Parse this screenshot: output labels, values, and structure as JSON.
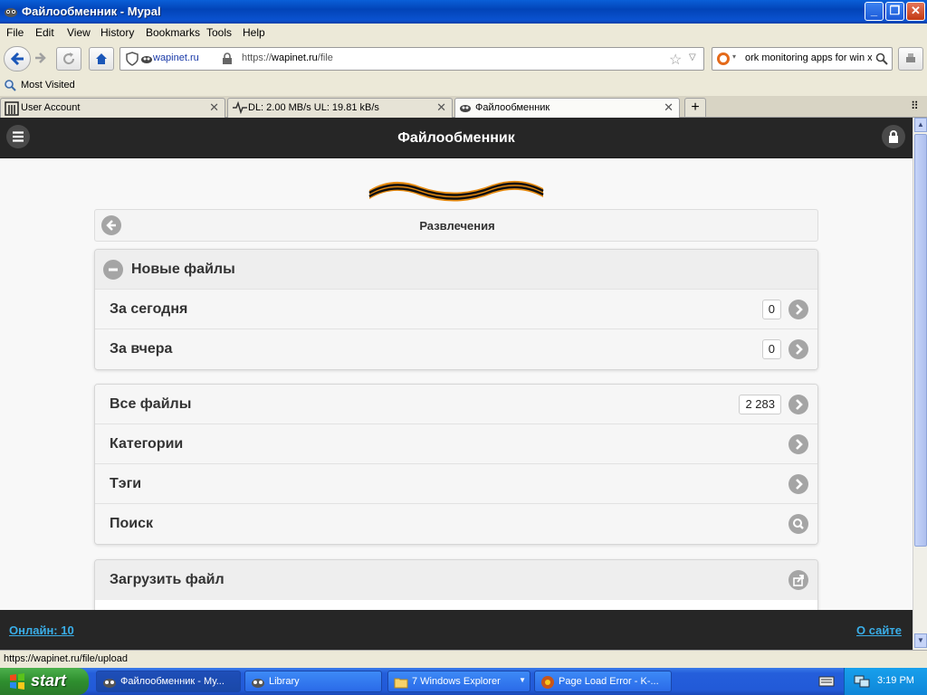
{
  "window": {
    "title": "Файлообменник - Mypal"
  },
  "menu": {
    "items": [
      "File",
      "Edit",
      "View",
      "History",
      "Bookmarks",
      "Tools",
      "Help"
    ]
  },
  "nav": {
    "site_identity": "wapinet.ru",
    "url_prefix": "https://",
    "url_host": "wapinet.ru",
    "url_path": "/file",
    "search_text": "ork monitoring apps for win x"
  },
  "bookmarks": {
    "most_visited": "Most Visited"
  },
  "tabs": [
    {
      "label": "User Account"
    },
    {
      "label": "DL: 2.00 MB/s UL: 19.81 kB/s"
    },
    {
      "label": "Файлообменник"
    }
  ],
  "site": {
    "header_title": "Файлообменник",
    "breadcrumb": "Развлечения",
    "new_files": {
      "heading": "Новые файлы",
      "rows": [
        {
          "label": "За сегодня",
          "count": "0"
        },
        {
          "label": "За вчера",
          "count": "0"
        }
      ]
    },
    "main_rows": [
      {
        "label": "Все файлы",
        "count": "2 283"
      },
      {
        "label": "Категории"
      },
      {
        "label": "Тэги"
      },
      {
        "label": "Поиск"
      }
    ],
    "upload_label": "Загрузить файл",
    "footer_online": "Онлайн: 10",
    "footer_about": "О сайте"
  },
  "status": {
    "text": "https://wapinet.ru/file/upload"
  },
  "taskbar": {
    "start_label": "start",
    "tasks": [
      {
        "label": "Файлообменник - Му..."
      },
      {
        "label": "Library"
      },
      {
        "label": "7 Windows Explorer"
      },
      {
        "label": "Page Load Error - K-..."
      }
    ],
    "clock": "3:19 PM"
  }
}
